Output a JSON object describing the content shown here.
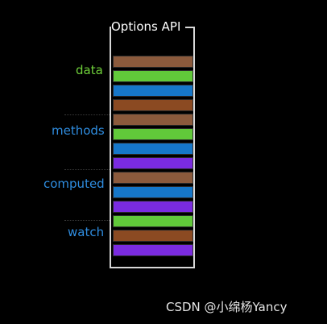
{
  "title": "Options API",
  "sections": [
    {
      "label": "data",
      "color": "#6fd03a",
      "bars": [
        "#8b5a3c",
        "#61c93a",
        "#1677c9",
        "#8b4a22"
      ]
    },
    {
      "label": "methods",
      "color": "#2f8de0",
      "bars": [
        "#8b5a3c",
        "#61c93a",
        "#1677c9",
        "#7a2be0"
      ]
    },
    {
      "label": "computed",
      "color": "#2f8de0",
      "bars": [
        "#8b5a3c",
        "#1677c9",
        "#7a2be0"
      ]
    },
    {
      "label": "watch",
      "color": "#2f8de0",
      "bars": [
        "#61c93a",
        "#8b4a22",
        "#7a2be0"
      ]
    }
  ],
  "watermark": "CSDN @小绵杨Yancy"
}
